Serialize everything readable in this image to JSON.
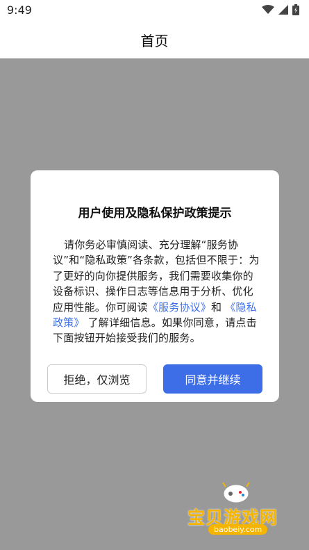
{
  "status_bar": {
    "time": "9:49"
  },
  "app_bar": {
    "title": "首页"
  },
  "dialog": {
    "title": "用户使用及隐私保护政策提示",
    "body_part1": "请你务必审慎阅读、充分理解“服务协议”和“隐私政策”各条款，包括但不限于：为了更好的向你提供服务，我们需要收集你的设备标识、操作日志等信息用于分析、优化应用性能。你可阅读",
    "link_service": "《服务协议》",
    "body_and": "和",
    "link_privacy": "《隐私政策》",
    "body_part2": "了解详细信息。如果你同意，请点击下面按钮开始接受我们的服务。",
    "reject_label": "拒绝，仅浏览",
    "agree_label": "同意并继续"
  },
  "watermark": {
    "text": "宝贝游戏网",
    "url": "baobeiy.com"
  },
  "colors": {
    "accent": "#3d6ee8",
    "overlay": "#999999",
    "watermark": "#f5b400"
  }
}
